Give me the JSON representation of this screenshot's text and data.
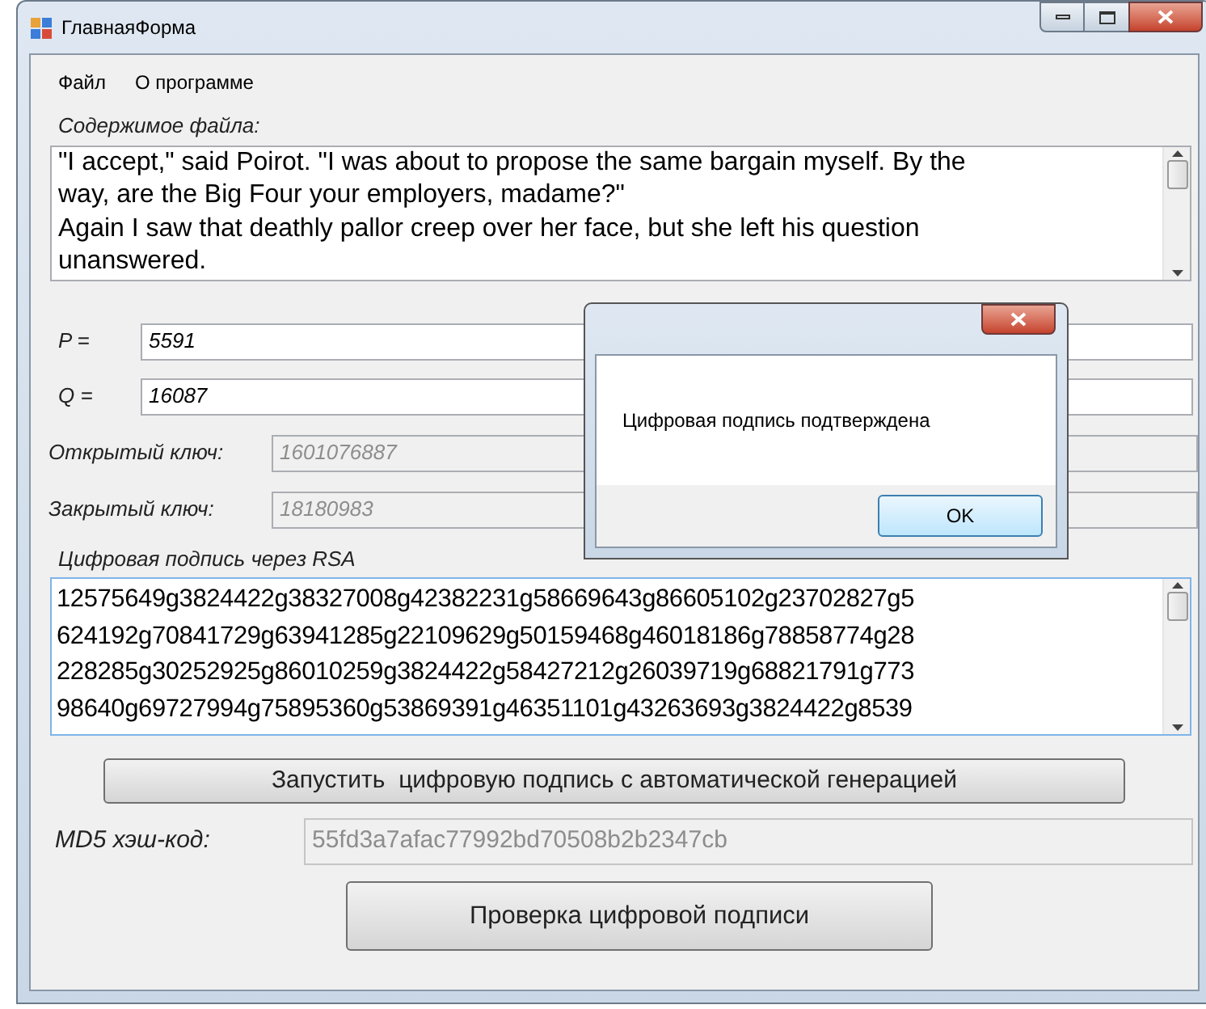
{
  "window": {
    "title": "ГлавнаяФорма"
  },
  "menu": [
    "Файл",
    "О программе"
  ],
  "file_content": {
    "label": "Содержимое файла:",
    "lines": [
      "\"I accept,\" said Poirot. \"I was about to propose the same bargain myself. By the",
      "way, are the Big Four your employers, madame?\"",
      "Again I saw that deathly pallor creep over her face, but she left his question",
      "unanswered."
    ]
  },
  "fields": [
    {
      "label": "P =",
      "value": "5591",
      "disabled": false
    },
    {
      "label": "Q =",
      "value": "16087",
      "disabled": false
    },
    {
      "label": "Открытый ключ:",
      "value": "1601076887",
      "disabled": true
    },
    {
      "label": "Закрытый ключ:",
      "value": "18180983",
      "disabled": true
    }
  ],
  "signature": {
    "label": "Цифровая подпись через RSA",
    "lines": [
      "12575649g3824422g38327008g42382231g58669643g86605102g23702827g5",
      "624192g70841729g63941285g22109629g50159468g46018186g78858774g28",
      "228285g30252925g86010259g3824422g58427212g26039719g68821791g773",
      "98640g69727994g75895360g53869391g46351101g43263693g3824422g8539"
    ]
  },
  "run_button": "Запустить  цифровую подпись с автоматической генерацией",
  "md5": {
    "label": "MD5 хэш-код:",
    "value": "55fd3a7afac77992bd70508b2b2347cb",
    "disabled": true
  },
  "verify_button": "Проверка цифровой подписи",
  "dialog": {
    "message": "Цифровая подпись подтверждена",
    "button": "OK"
  }
}
